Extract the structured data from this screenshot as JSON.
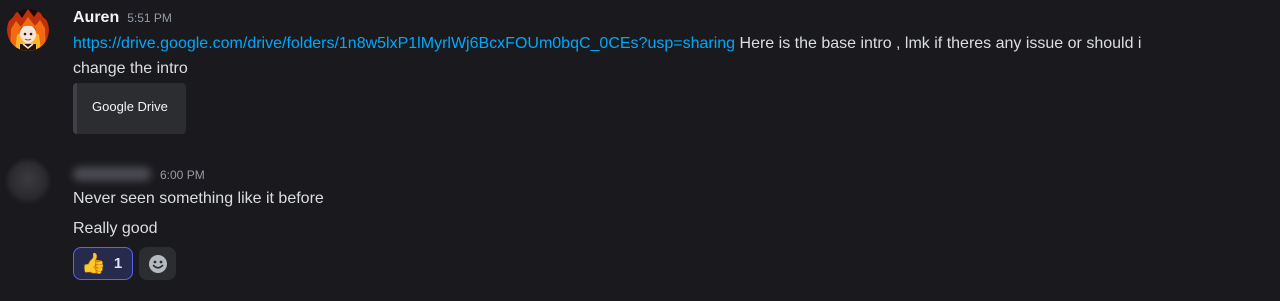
{
  "messages": [
    {
      "author": "Auren",
      "timestamp": "5:51 PM",
      "link": "https://drive.google.com/drive/folders/1n8w5lxP1lMyrlWj6BcxFOUm0bqC_0CEs?usp=sharing",
      "text_line1": " Here is the base intro , lmk if theres any issue or should i",
      "text_line2": "change the intro",
      "embed": {
        "title": "Google Drive"
      }
    },
    {
      "timestamp": "6:00 PM",
      "lines": [
        "Never seen something like it before",
        "Really good"
      ],
      "reactions": [
        {
          "emoji": "👍",
          "count": "1",
          "icon": "thumbs-up-icon"
        }
      ],
      "add_reaction_icon": "smiley-add-icon"
    }
  ],
  "colors": {
    "background": "#1a1a1e",
    "link": "#00a8fc",
    "reaction_border": "#5865f2"
  }
}
